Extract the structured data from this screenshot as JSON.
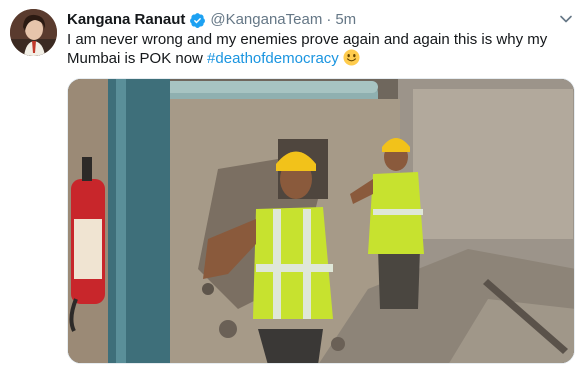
{
  "tweet": {
    "display_name": "Kangana Ranaut",
    "handle": "@KanganaTeam",
    "separator": "·",
    "time": "5m",
    "text_main": "I am never wrong and my enemies prove again and again this is why my Mumbai is POK now ",
    "hashtag": "#deathofdemocracy",
    "verified": true
  },
  "icons": {
    "verified": "verified-badge-icon",
    "caret": "chevron-down-icon",
    "emoji": "slightly-smiling-face-emoji"
  },
  "colors": {
    "link": "#1b95e0",
    "secondary_text": "#657786",
    "verified_badge": "#1da1f2"
  }
}
